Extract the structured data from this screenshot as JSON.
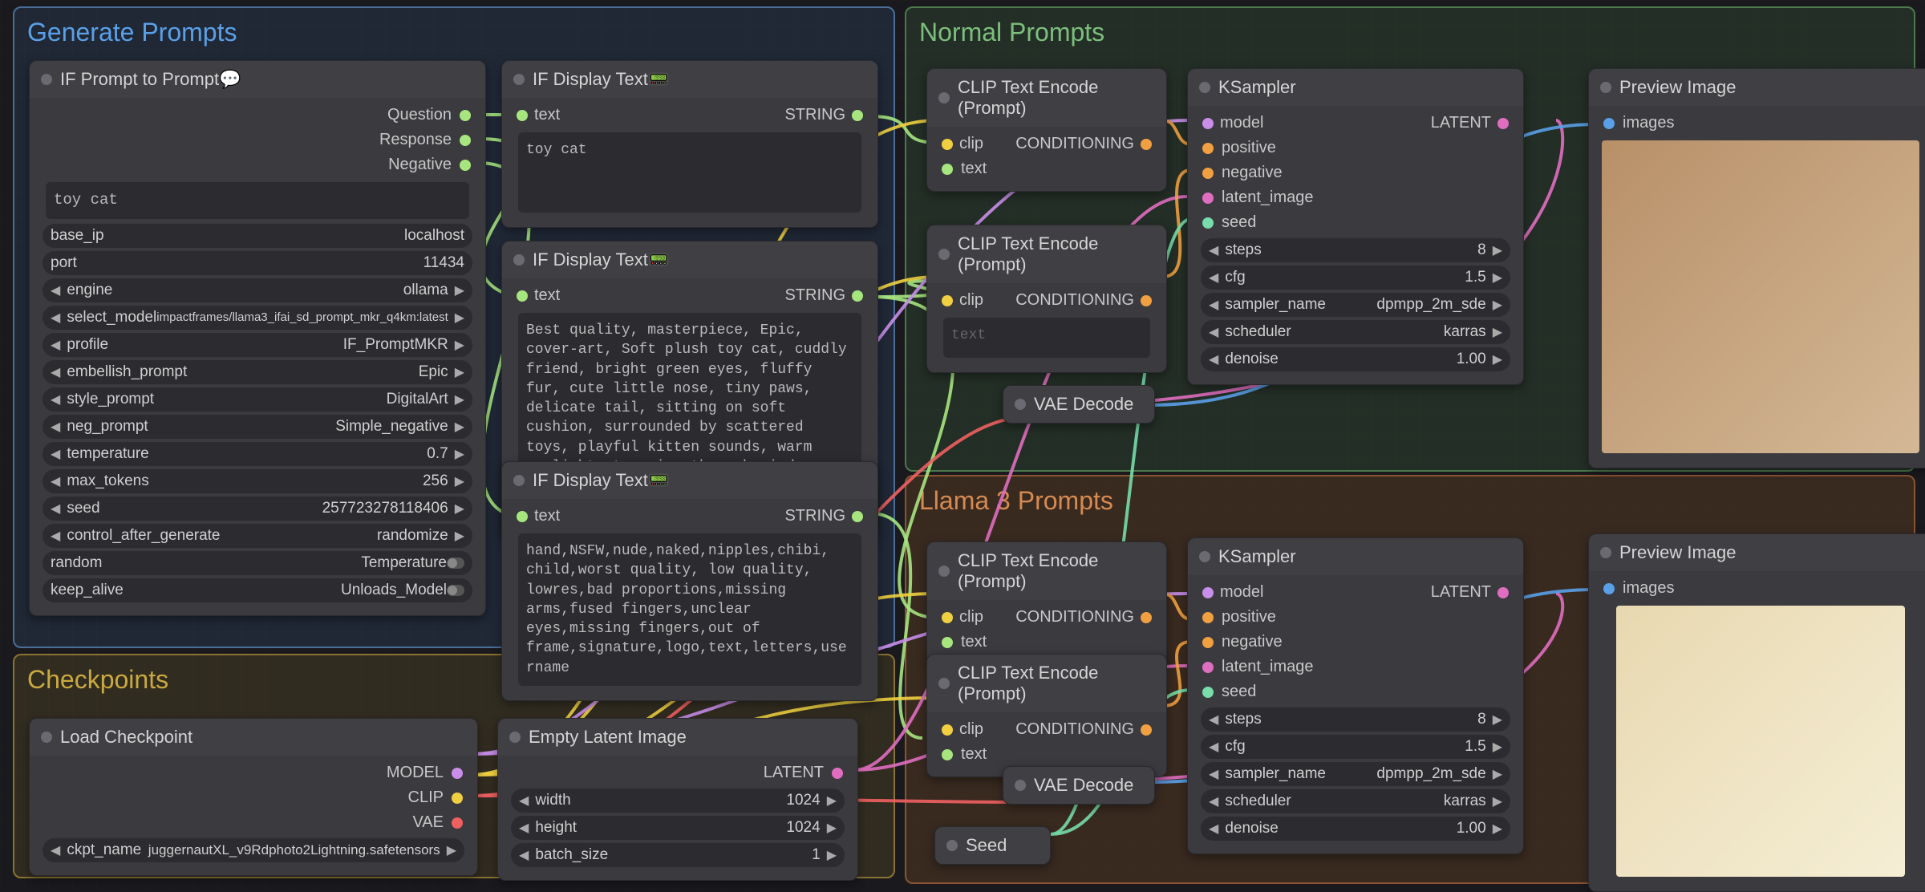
{
  "colors": {
    "string": "#a7e67f",
    "model": "#c98eea",
    "clip": "#f0d040",
    "vae": "#f06060",
    "latent": "#e06ec0",
    "cond": "#f0a040",
    "img": "#5aa0e8",
    "int": "#7da"
  },
  "groups": {
    "gen": "Generate Prompts",
    "norm": "Normal Prompts",
    "llama": "Llama 3 Prompts",
    "ckpt": "Checkpoints"
  },
  "nodes": {
    "ifprompt": {
      "title": "IF Prompt to Prompt💬",
      "outs": [
        "Question",
        "Response",
        "Negative"
      ],
      "text": "toy cat",
      "params": [
        {
          "k": "base_ip",
          "v": "localhost",
          "arrows": "none"
        },
        {
          "k": "port",
          "v": "11434",
          "arrows": "none"
        },
        {
          "k": "engine",
          "v": "ollama",
          "arrows": "both"
        },
        {
          "k": "select_model",
          "v": "impactframes/llama3_ifai_sd_prompt_mkr_q4km:latest",
          "arrows": "both",
          "small": true
        },
        {
          "k": "profile",
          "v": "IF_PromptMKR",
          "arrows": "both"
        },
        {
          "k": "embellish_prompt",
          "v": "Epic",
          "arrows": "both"
        },
        {
          "k": "style_prompt",
          "v": "DigitalArt",
          "arrows": "both"
        },
        {
          "k": "neg_prompt",
          "v": "Simple_negative",
          "arrows": "both"
        },
        {
          "k": "temperature",
          "v": "0.7",
          "arrows": "both"
        },
        {
          "k": "max_tokens",
          "v": "256",
          "arrows": "both"
        },
        {
          "k": "seed",
          "v": "257723278118406",
          "arrows": "both"
        },
        {
          "k": "control_after_generate",
          "v": "randomize",
          "arrows": "both"
        },
        {
          "k": "random",
          "v": "Temperature",
          "arrows": "none",
          "toggle": true
        },
        {
          "k": "keep_alive",
          "v": "Unloads_Model",
          "arrows": "none",
          "toggle": true
        }
      ]
    },
    "disp1": {
      "title": "IF Display Text📟",
      "inlabel": "text",
      "outlabel": "STRING",
      "text": "toy cat"
    },
    "disp2": {
      "title": "IF Display Text📟",
      "inlabel": "text",
      "outlabel": "STRING",
      "text": "Best quality, masterpiece, Epic, cover-art, Soft plush toy cat, cuddly friend, bright green eyes, fluffy fur, cute little nose, tiny paws, delicate tail, sitting on soft cushion, surrounded by scattered toys, playful kitten sounds, warm sunlight streaming through window. digital art, vector graphics, flat stylized design"
    },
    "disp3": {
      "title": "IF Display Text📟",
      "inlabel": "text",
      "outlabel": "STRING",
      "text": "hand,NSFW,nude,naked,nipples,chibi, child,worst quality, low quality, lowres,bad proportions,missing arms,fused fingers,unclear eyes,missing fingers,out of frame,signature,logo,text,letters,username"
    },
    "loadckpt": {
      "title": "Load Checkpoint",
      "outs": [
        "MODEL",
        "CLIP",
        "VAE"
      ],
      "param_k": "ckpt_name",
      "param_v": "juggernautXL_v9Rdphoto2Lightning.safetensors"
    },
    "empty": {
      "title": "Empty Latent Image",
      "outlabel": "LATENT",
      "params": [
        {
          "k": "width",
          "v": "1024"
        },
        {
          "k": "height",
          "v": "1024"
        },
        {
          "k": "batch_size",
          "v": "1"
        }
      ]
    },
    "clipenc": {
      "title": "CLIP Text Encode (Prompt)",
      "ins": [
        "clip",
        "text"
      ],
      "out": "CONDITIONING",
      "placeholder": "text"
    },
    "ksampler": {
      "title": "KSampler",
      "ins": [
        "model",
        "positive",
        "negative",
        "latent_image",
        "seed"
      ],
      "out": "LATENT",
      "params": [
        {
          "k": "steps",
          "v": "8"
        },
        {
          "k": "cfg",
          "v": "1.5"
        },
        {
          "k": "sampler_name",
          "v": "dpmpp_2m_sde"
        },
        {
          "k": "scheduler",
          "v": "karras"
        },
        {
          "k": "denoise",
          "v": "1.00"
        }
      ]
    },
    "vaedec": {
      "title": "VAE Decode"
    },
    "preview": {
      "title": "Preview Image",
      "in": "images"
    },
    "seed": {
      "title": "Seed"
    }
  }
}
